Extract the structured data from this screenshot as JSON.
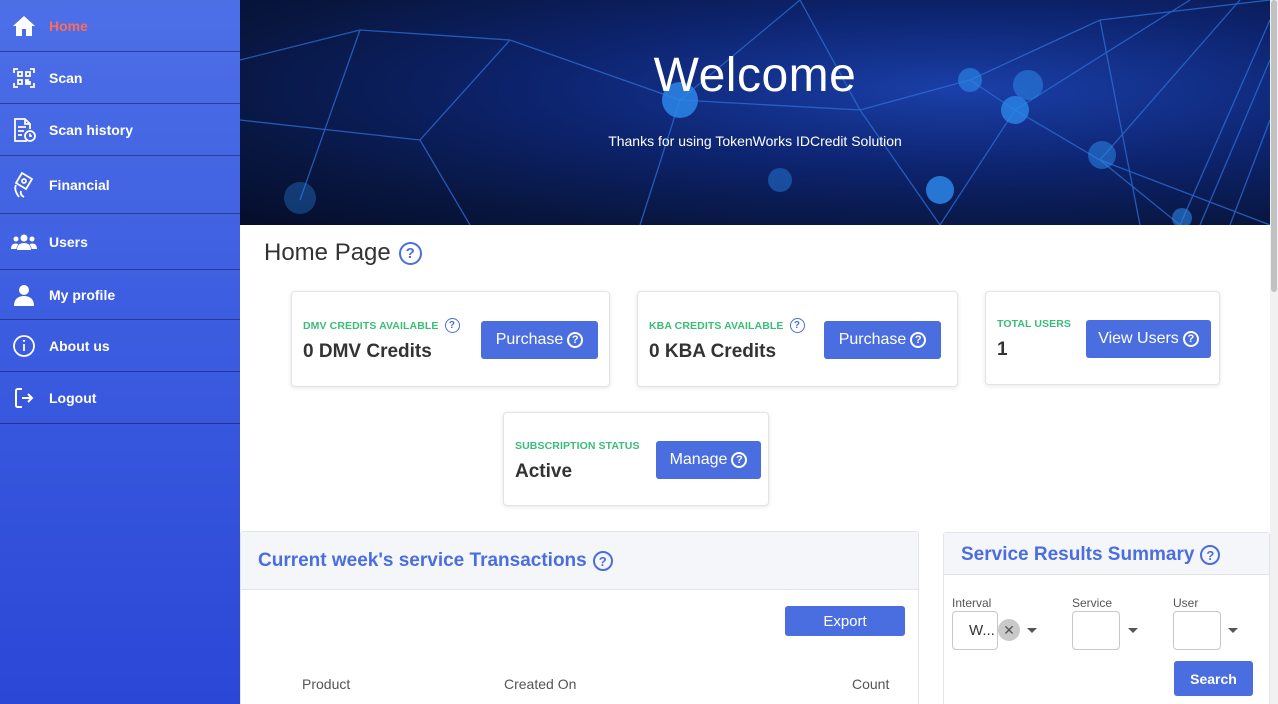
{
  "sidebar": {
    "items": [
      {
        "label": "Home",
        "icon": "home-icon",
        "active": true
      },
      {
        "label": "Scan",
        "icon": "qr-scan-icon"
      },
      {
        "label": "Scan history",
        "icon": "document-clock-icon"
      },
      {
        "label": "Financial",
        "icon": "hand-money-icon"
      },
      {
        "label": "Users",
        "icon": "users-icon"
      },
      {
        "label": "My profile",
        "icon": "user-icon"
      },
      {
        "label": "About us",
        "icon": "info-icon"
      },
      {
        "label": "Logout",
        "icon": "logout-icon"
      }
    ]
  },
  "banner": {
    "title": "Welcome",
    "subtitle": "Thanks for using TokenWorks IDCredit Solution"
  },
  "page": {
    "title": "Home Page"
  },
  "cards": {
    "dmv": {
      "caption": "DMV CREDITS AVAILABLE",
      "value": "0 DMV Credits",
      "button": "Purchase"
    },
    "kba": {
      "caption": "KBA CREDITS AVAILABLE",
      "value": "0 KBA Credits",
      "button": "Purchase"
    },
    "users": {
      "caption": "TOTAL USERS",
      "value": "1",
      "button": "View Users"
    },
    "subscription": {
      "caption": "SUBSCRIPTION STATUS",
      "value": "Active",
      "button": "Manage"
    }
  },
  "transactions": {
    "title": "Current week's service Transactions",
    "export_label": "Export",
    "columns": [
      "Product",
      "Created On",
      "Count"
    ]
  },
  "summary": {
    "title": "Service Results Summary",
    "interval_label": "Interval",
    "interval_value": "W...",
    "service_label": "Service",
    "service_value": "",
    "user_label": "User",
    "user_value": "",
    "search_label": "Search"
  },
  "colors": {
    "accent": "#4a6ee0",
    "active_nav": "#ff6b5a",
    "caption_green": "#3bbd7a",
    "sidebar": "#3b5be0"
  }
}
